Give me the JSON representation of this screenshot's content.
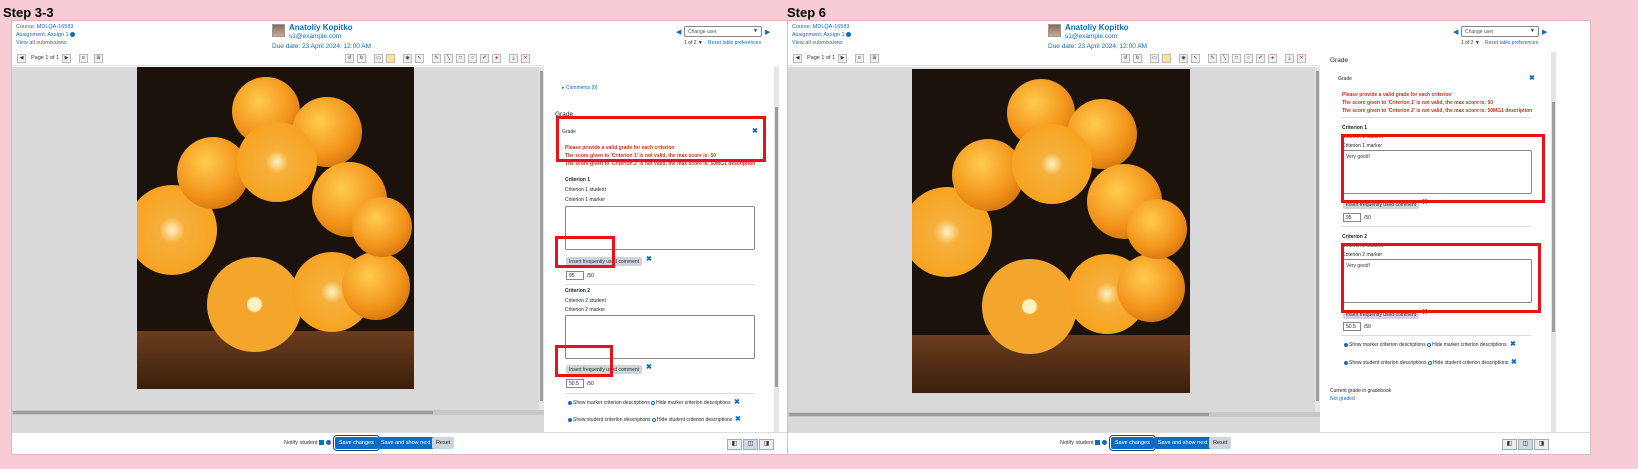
{
  "left": {
    "step_title": "Step 3-3",
    "course": "Course: MDLQA-16583",
    "assignment": "Assignment: Assign 1",
    "view_all": "View all submissions",
    "user_name": "Anatoliy Kopitko",
    "user_email": "s1@example.com",
    "due_date": "Due date: 23 April 2024, 12:00 AM",
    "change_user": "Change user",
    "user_count": "1 of 2",
    "table_prefs": "Reset table preferences",
    "page_label": "Page 1 of 1",
    "comments_link": "Comments (0)",
    "grade_heading": "Grade",
    "grade_sub": "Grade",
    "errors": [
      "Please provide a valid grade for each criterion",
      "The score given to 'Criterion 1' is not valid, the max score is: 50",
      "The score given to 'Criterion 2' is not valid, the max score is: 50MG1 description"
    ],
    "crit1": {
      "title": "Criterion 1",
      "student": "Criterion 1 student",
      "marker": "Criterion 1 marker",
      "text": "",
      "score": "95",
      "max": "/50"
    },
    "crit2": {
      "title": "Criterion 2",
      "student": "Criterion 2 student",
      "marker": "Criterion 2 marker",
      "text": "",
      "score": "50.5",
      "max": "/50"
    },
    "insert_btn": "Insert frequently used comment",
    "radio1_show": "Show marker criterion descriptions",
    "radio1_hide": "Hide marker criterion descriptions",
    "radio2_show": "Show student criterion descriptions",
    "radio2_hide": "Hide student criterion descriptions"
  },
  "right": {
    "step_title": "Step 6",
    "course": "Course: MDLQA-16583",
    "assignment": "Assignment: Assign 1",
    "view_all": "View all submissions",
    "user_name": "Anatoliy Kopitko",
    "user_email": "s1@example.com",
    "due_date": "Due date: 23 April 2024, 12:00 AM",
    "change_user": "Change user",
    "user_count": "1 of 2",
    "table_prefs": "Reset table preferences",
    "page_label": "Page 1 of 1",
    "grade_heading": "Grade",
    "grade_sub": "Grade",
    "errors": [
      "Please provide a valid grade for each criterion",
      "The score given to 'Criterion 1' is not valid, the max score is: 50",
      "The score given to 'Criterion 2' is not valid, the max score is: 50MG1 description"
    ],
    "crit1": {
      "title": "Criterion 1",
      "student": "Criterion 1 student",
      "marker": "Criterion 1 marker",
      "text": "Very good!",
      "score": "95",
      "max": "/50"
    },
    "crit2": {
      "title": "Criterion 2",
      "student": "Criterion 2 student",
      "marker": "Criterion 2 marker",
      "text": "Very good!",
      "score": "50.5",
      "max": "/50"
    },
    "insert_btn": "Insert frequently used comment",
    "radio1_show": "Show marker criterion descriptions",
    "radio1_hide": "Hide marker criterion descriptions",
    "radio2_show": "Show student criterion descriptions",
    "radio2_hide": "Hide student criterion descriptions",
    "gradebook_label": "Current grade in gradebook",
    "gradebook_value": "Not graded"
  },
  "footer": {
    "notify": "Notify student",
    "save": "Save changes",
    "save_next": "Save and show next",
    "reset": "Reset"
  },
  "colors": {
    "accent": "#0f6cbf",
    "error": "#ca3120",
    "highlight": "#e8121b",
    "background": "#f7ccd5"
  }
}
